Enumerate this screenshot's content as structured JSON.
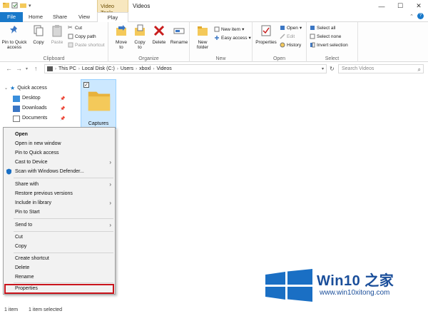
{
  "window": {
    "title": "Videos",
    "context_tab": "Video Tools",
    "controls": [
      "—",
      "☐",
      "✕"
    ]
  },
  "tabs": [
    "File",
    "Home",
    "Share",
    "View",
    "Play"
  ],
  "ribbon": {
    "clipboard": {
      "label": "Clipboard",
      "pin_line1": "Pin to Quick",
      "pin_line2": "access",
      "copy": "Copy",
      "paste": "Paste",
      "cut": "Cut",
      "copy_path": "Copy path",
      "paste_shortcut": "Paste shortcut"
    },
    "organize": {
      "label": "Organize",
      "move_to_l1": "Move",
      "move_to_l2": "to",
      "copy_to_l1": "Copy",
      "copy_to_l2": "to",
      "delete": "Delete",
      "rename": "Rename"
    },
    "new": {
      "label": "New",
      "new_folder_l1": "New",
      "new_folder_l2": "folder",
      "new_item": "New item",
      "easy_access": "Easy access"
    },
    "open": {
      "label": "Open",
      "properties": "Properties",
      "open": "Open",
      "edit": "Edit",
      "history": "History"
    },
    "select": {
      "label": "Select",
      "select_all": "Select all",
      "select_none": "Select none",
      "invert_selection": "Invert selection"
    }
  },
  "address": {
    "crumbs": [
      "This PC",
      "Local Disk (C:)",
      "Users",
      "xboxl",
      "Videos"
    ],
    "search_placeholder": "Search Videos"
  },
  "sidebar": {
    "quick_access": "Quick access",
    "items": [
      "Desktop",
      "Downloads",
      "Documents"
    ]
  },
  "content": {
    "folder_name": "Captures"
  },
  "context_menu": {
    "items": [
      "Open",
      "Open in new window",
      "Pin to Quick access",
      "Cast to Device",
      "Scan with Windows Defender...",
      "Share with",
      "Restore previous versions",
      "Include in library",
      "Pin to Start",
      "Send to",
      "Cut",
      "Copy",
      "Create shortcut",
      "Delete",
      "Rename",
      "Properties"
    ]
  },
  "status": {
    "count": "1 item",
    "selected": "1 item selected"
  },
  "watermark": {
    "brand": "Win10 之家",
    "url": "www.win10xitong.com"
  },
  "colors": {
    "accent": "#1979ca",
    "context_tab": "#f7e7bf",
    "selection": "#cce8ff",
    "highlight_box": "#c9141c",
    "folder": "#f4c95a",
    "logo": "#1a6fc4"
  }
}
